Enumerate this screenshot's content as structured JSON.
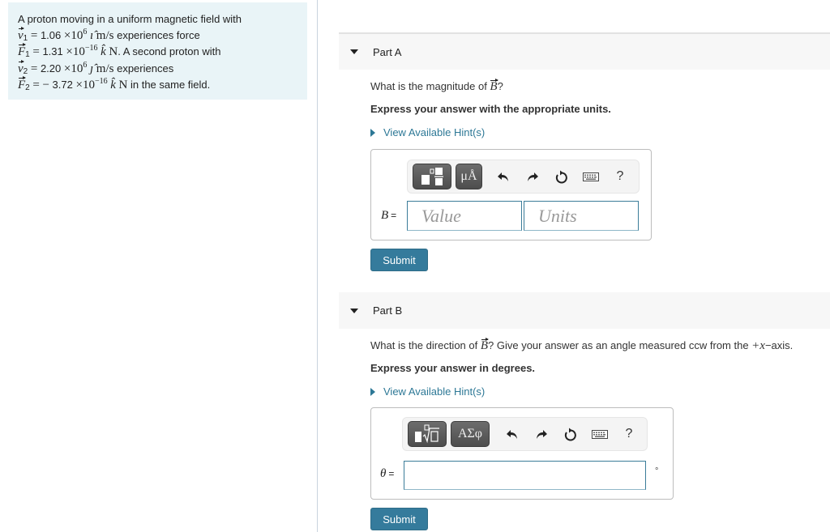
{
  "problem": {
    "intro": "A proton moving in a uniform magnetic field with",
    "v1_label": "v",
    "v1_sub": "1",
    "v1_value": "1.06",
    "v1_exp": "6",
    "v1_unit_vec": "ı̂",
    "v1_unit": "m/s",
    "v1_tail": "experiences force",
    "f1_label": "F",
    "f1_sub": "1",
    "f1_value": "1.31",
    "f1_exp": "−16",
    "f1_unit_vec": "k̂",
    "f1_unit": "N",
    "f1_tail": ". A second proton with",
    "v2_label": "v",
    "v2_sub": "2",
    "v2_value": "2.20",
    "v2_exp": "6",
    "v2_unit_vec": "ȷ̂",
    "v2_unit": "m/s",
    "v2_tail": "experiences",
    "f2_label": "F",
    "f2_sub": "2",
    "f2_sign": "−",
    "f2_value": "3.72",
    "f2_exp": "−16",
    "f2_unit_vec": "k̂",
    "f2_unit": "N",
    "f2_tail": "in the same field.",
    "times": "×10",
    "equals": "="
  },
  "part_a": {
    "title": "Part A",
    "question_pre": "What is the magnitude of ",
    "question_var": "B",
    "question_post": "?",
    "instruction": "Express your answer with the appropriate units.",
    "hint_label": "View Available Hint(s)",
    "toolbar": {
      "template_icon": "fraction-template-icon",
      "units_label": "μÅ",
      "undo_icon": "undo-icon",
      "redo_icon": "redo-icon",
      "reset_icon": "reset-icon",
      "keyboard_icon": "keyboard-icon",
      "help_label": "?"
    },
    "var_label": "B",
    "eq": "=",
    "value_placeholder": "Value",
    "units_placeholder": "Units",
    "submit_label": "Submit"
  },
  "part_b": {
    "title": "Part B",
    "question_pre": "What is the direction of ",
    "question_var": "B",
    "question_post": "? Give your answer as an angle measured ccw from the ",
    "question_axis": "+x",
    "question_end": "−axis.",
    "instruction": "Express your answer in degrees.",
    "hint_label": "View Available Hint(s)",
    "toolbar": {
      "template_icon": "radical-template-icon",
      "symbols_label": "ΑΣφ",
      "undo_icon": "undo-icon",
      "redo_icon": "redo-icon",
      "reset_icon": "reset-icon",
      "keyboard_icon": "keyboard-icon",
      "help_label": "?"
    },
    "var_label": "θ",
    "eq": "=",
    "answer_value": "",
    "unit_symbol": "°",
    "submit_label": "Submit"
  }
}
